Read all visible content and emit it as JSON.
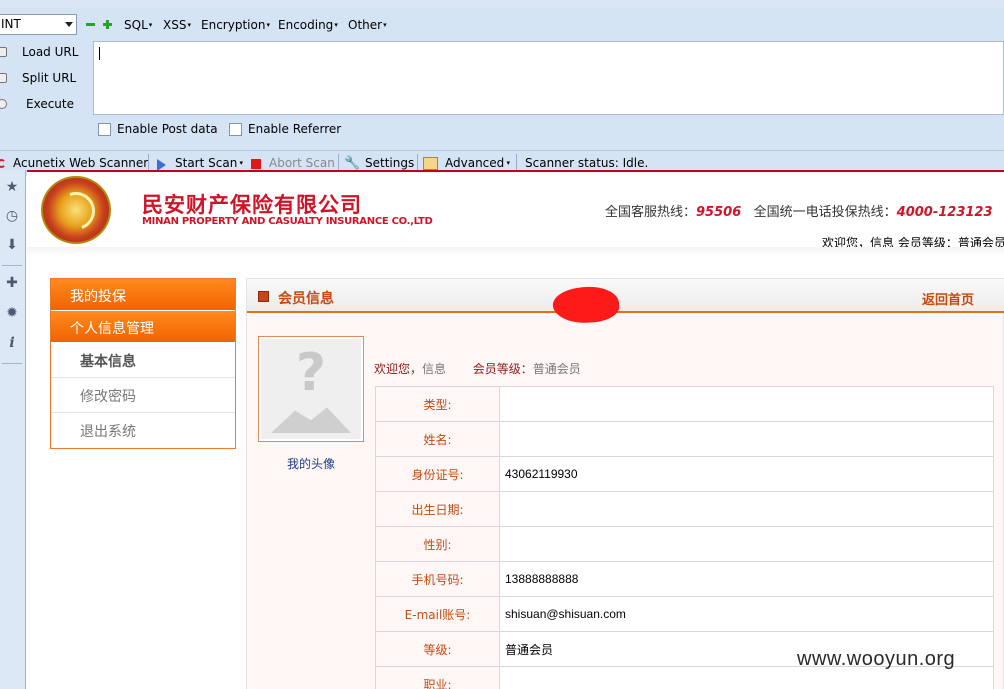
{
  "browser": {
    "hackbar": {
      "select_value": "INT",
      "menus": [
        "SQL",
        "XSS",
        "Encryption",
        "Encoding",
        "Other"
      ],
      "side_buttons": [
        "Load URL",
        "Split URL",
        "Execute"
      ],
      "url_value": "",
      "checkboxes": [
        "Enable Post data",
        "Enable Referrer"
      ]
    },
    "scanner": {
      "name": "Acunetix Web Scanner",
      "start_scan": "Start Scan",
      "abort_scan": "Abort Scan",
      "settings": "Settings",
      "advanced": "Advanced",
      "status": "Scanner status: Idle."
    }
  },
  "site": {
    "company_cn": "民安财产保险有限公司",
    "company_en": "MINAN PROPERTY AND CASUALTY INSURANCE CO.,LTD",
    "hotline_label_1": "全国客服热线：",
    "hotline_num_1": "95506",
    "hotline_label_2": "全国统一电话投保热线：",
    "hotline_num_2": "4000-123123",
    "welcome_top": "欢迎您，信息 会员等级：普通会员",
    "colors": {
      "brand_red": "#d01428",
      "nav_orange": "#f26300",
      "label_orange": "#c54a10"
    }
  },
  "sidenav": {
    "headers": [
      "我的投保",
      "个人信息管理"
    ],
    "items": [
      "基本信息",
      "修改密码",
      "退出系统"
    ]
  },
  "panel": {
    "title": "会员信息",
    "back_link": "返回首页",
    "avatar_label": "我的头像",
    "welcome_label": "欢迎您，",
    "welcome_name": "信息",
    "level_label": "会员等级：",
    "level_value": "普通会员"
  },
  "member_table": [
    {
      "label": "类型:",
      "value": ""
    },
    {
      "label": "姓名:",
      "value": ""
    },
    {
      "label": "身份证号:",
      "value": "43062119930"
    },
    {
      "label": "出生日期:",
      "value": ""
    },
    {
      "label": "性别:",
      "value": ""
    },
    {
      "label": "手机号码:",
      "value": "13888888888"
    },
    {
      "label": "E-mail账号:",
      "value": "shisuan@shisuan.com"
    },
    {
      "label": "等级:",
      "value": "普通会员"
    },
    {
      "label": "职业:",
      "value": ""
    }
  ],
  "watermark": "www.wooyun.org"
}
